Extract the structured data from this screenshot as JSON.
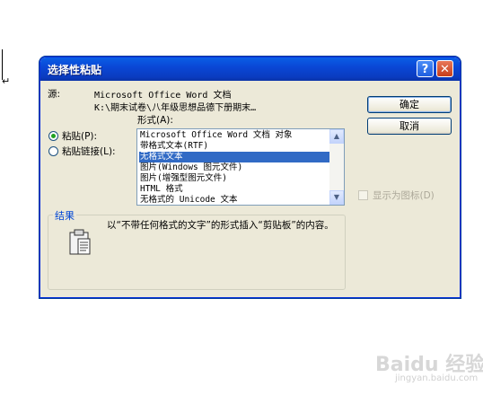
{
  "dialog": {
    "title": "选择性粘贴",
    "help_label": "?",
    "close_label": "✕",
    "source_label": "源:",
    "source_app": "Microsoft Office Word 文档",
    "source_path": "K:\\期末试卷\\八年级思想品德下册期末…",
    "format_label": "形式(A):",
    "paste_label": "粘贴(P):",
    "paste_link_label": "粘贴链接(L):",
    "formats": [
      "Microsoft Office Word 文档 对象",
      "带格式文本(RTF)",
      "无格式文本",
      "图片(Windows 图元文件)",
      "图片(增强型图元文件)",
      "HTML 格式",
      "无格式的 Unicode 文本"
    ],
    "selected_format_index": 2,
    "ok_label": "确定",
    "cancel_label": "取消",
    "show_as_icon_label": "显示为图标(D)",
    "result_title": "结果",
    "result_text": "以“不带任何格式的文字”的形式插入“剪贴板”的内容。"
  },
  "watermark": {
    "main": "Baidu 经验",
    "sub": "jingyan.baidu.com"
  }
}
